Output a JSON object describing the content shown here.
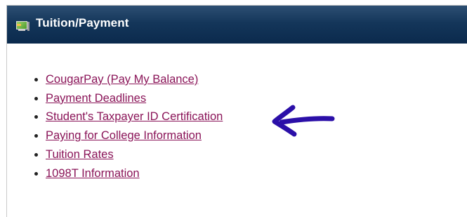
{
  "panel": {
    "title": "Tuition/Payment",
    "icon": "computer-icon"
  },
  "links": [
    {
      "label": "CougarPay (Pay My Balance)"
    },
    {
      "label": "Payment Deadlines"
    },
    {
      "label": "Student's Taxpayer ID Certification"
    },
    {
      "label": "Paying for College Information"
    },
    {
      "label": "Tuition Rates"
    },
    {
      "label": "1098T Information"
    }
  ],
  "annotation": {
    "type": "arrow-pointing-left",
    "color": "#2b0fa8"
  },
  "colors": {
    "header_bg": "#14365a",
    "link": "#8a1458"
  }
}
